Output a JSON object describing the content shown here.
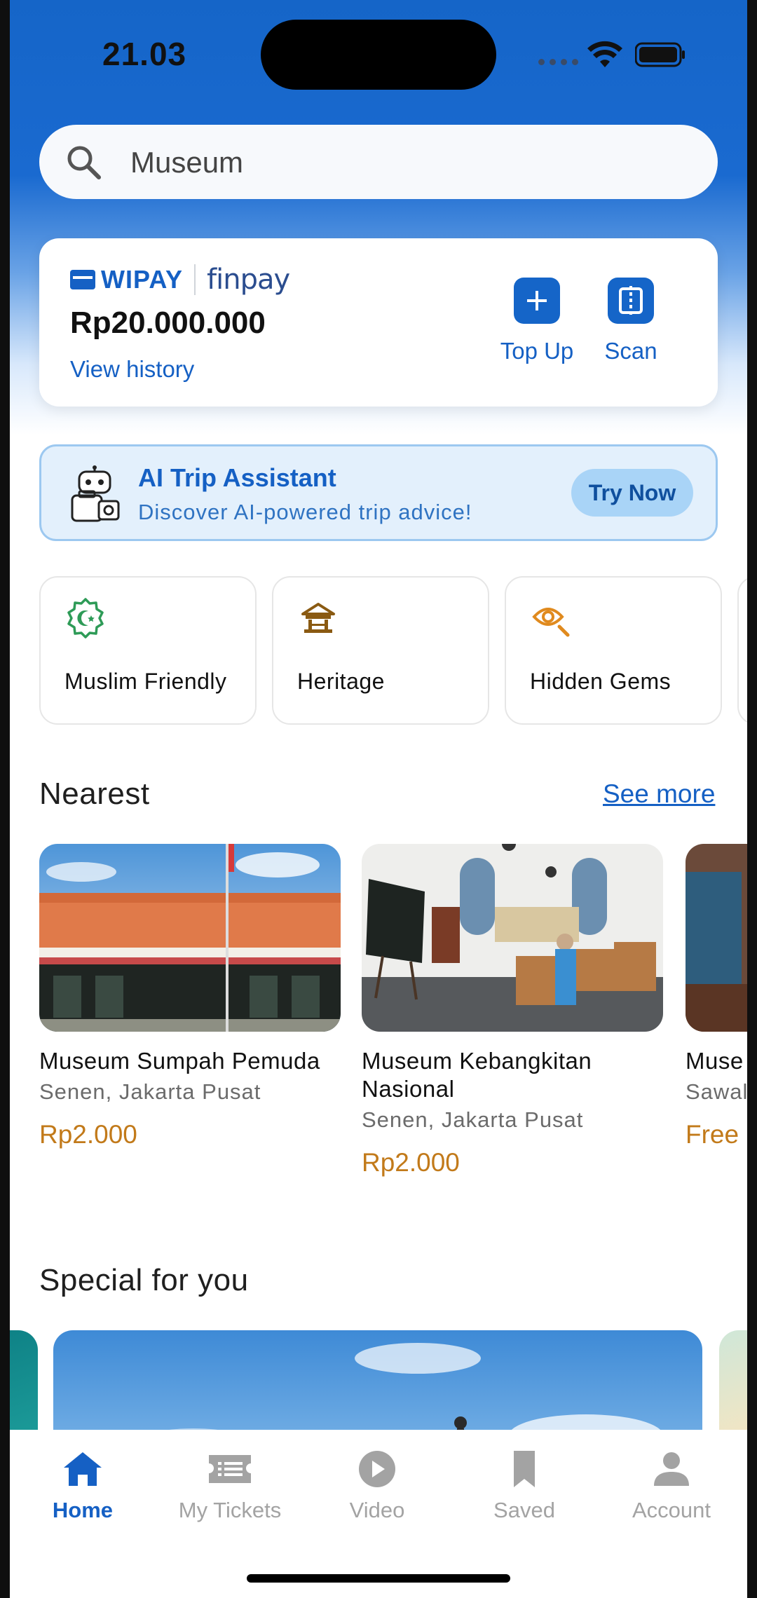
{
  "status_bar": {
    "time": "21.03"
  },
  "search": {
    "query": "Museum",
    "icon": "search-icon"
  },
  "wallet": {
    "brand_primary": "WIPAY",
    "brand_secondary": "finpay",
    "balance": "Rp20.000.000",
    "history_link": "View history",
    "actions": [
      {
        "label": "Top Up",
        "icon": "plus-icon"
      },
      {
        "label": "Scan",
        "icon": "scan-icon"
      }
    ]
  },
  "ai_banner": {
    "title": "AI Trip Assistant",
    "subtitle": "Discover AI-powered trip advice!",
    "button": "Try Now",
    "icon": "robot-icon"
  },
  "categories": [
    {
      "label": "Muslim Friendly",
      "icon": "crescent-badge-icon",
      "color": "#2e9b57"
    },
    {
      "label": "Heritage",
      "icon": "heritage-building-icon",
      "color": "#8a5a12"
    },
    {
      "label": "Hidden Gems",
      "icon": "eye-search-icon",
      "color": "#e08a1e"
    }
  ],
  "nearest": {
    "title": "Nearest",
    "see_more": "See more",
    "places": [
      {
        "name": "Museum Sumpah Pemuda",
        "location": "Senen, Jakarta Pusat",
        "price": "Rp2.000"
      },
      {
        "name": "Museum Kebangkitan Nasional",
        "location": "Senen, Jakarta Pusat",
        "price": "Rp2.000"
      },
      {
        "name": "Muse",
        "location": "Sawal",
        "price": "Free"
      }
    ]
  },
  "special": {
    "title": "Special for you"
  },
  "bottom_nav": {
    "items": [
      {
        "label": "Home",
        "icon": "home-icon",
        "active": true
      },
      {
        "label": "My Tickets",
        "icon": "ticket-icon",
        "active": false
      },
      {
        "label": "Video",
        "icon": "play-circle-icon",
        "active": false
      },
      {
        "label": "Saved",
        "icon": "bookmark-icon",
        "active": false
      },
      {
        "label": "Account",
        "icon": "person-icon",
        "active": false
      }
    ]
  },
  "colors": {
    "primary": "#1565c8",
    "price": "#c27a1a",
    "banner_bg": "#e3f0fc"
  }
}
